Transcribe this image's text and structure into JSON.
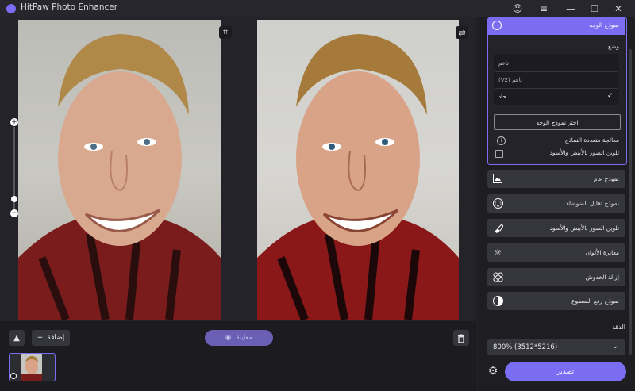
{
  "window": {
    "title": "HitPaw Photo Enhancer",
    "controls": {
      "account": "☺",
      "menu": "≡",
      "minimize": "—",
      "maximize": "☐",
      "close": "✕"
    }
  },
  "workspace": {
    "crop_icon": "⌗",
    "compare_icon": "⇄",
    "zoom": {
      "plus": "+",
      "minus": "−",
      "level_fraction": 0.87
    }
  },
  "bottom": {
    "collapse_icon": "▲",
    "add_label": "إضافة",
    "add_icon": "+",
    "preview_label": "معاينة",
    "preview_icon": "◉",
    "delete_icon": "🗑",
    "thumb_badge": "⊗"
  },
  "panel": {
    "face_model": {
      "header": "نموذج الوجه",
      "mode_label": "وضع",
      "modes": [
        "ناعم",
        "(V2) ناعم",
        "حاد"
      ],
      "selected_mode_check": "✓",
      "choose_button": "اختر نموذج الوجه",
      "multi_process_label": "معالجة متعددة النماذج",
      "bw_label": "تلوين الصور بالأبيض والأسود"
    },
    "models": [
      {
        "label": "نموذج عام",
        "icon": "image-icon"
      },
      {
        "label": "نموذج تقليل الضوضاء",
        "icon": "denoise-icon"
      },
      {
        "label": "تلوين الصور بالأبيض والأسود",
        "icon": "brush-icon"
      },
      {
        "label": "معايرة الألوان",
        "icon": "sun-icon"
      },
      {
        "label": "إزالة الخدوش",
        "icon": "bandage-icon"
      },
      {
        "label": "نموذج رفع السطوع",
        "icon": "contrast-icon"
      }
    ],
    "quality_label": "الدقة",
    "resolution": "800% (3512*5216)",
    "chevron": "⌄",
    "settings_icon": "⚙",
    "export_label": "تصدير"
  },
  "colors": {
    "accent": "#7b6df2",
    "panel_bg": "#1d1d22",
    "button_bg": "#35353c"
  }
}
